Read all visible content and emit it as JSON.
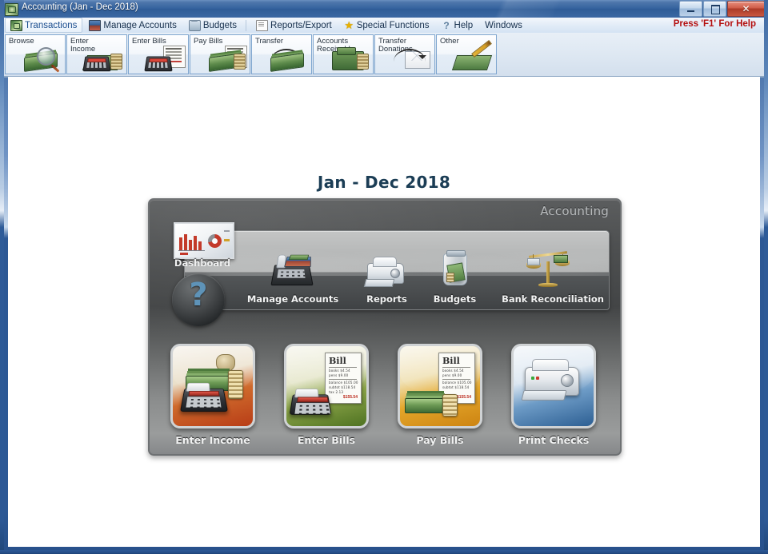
{
  "window": {
    "title": "Accounting (Jan - Dec 2018)",
    "title_icon": "money-icon",
    "controls": {
      "minimize": "minimize-button",
      "maximize": "maximize-button",
      "close_label": "✕"
    }
  },
  "menubar": {
    "items": [
      {
        "label": "Transactions",
        "icon": "money-icon",
        "active": true
      },
      {
        "label": "Manage Accounts",
        "icon": "books-icon",
        "active": false
      },
      {
        "label": "Budgets",
        "icon": "jar-icon",
        "active": false
      },
      {
        "label": "Reports/Export",
        "icon": "page-icon",
        "active": false
      },
      {
        "label": "Special Functions",
        "icon": "star-icon",
        "active": false
      },
      {
        "label": "Help",
        "icon": "help-icon",
        "active": false
      },
      {
        "label": "Windows",
        "icon": "none",
        "active": false
      }
    ],
    "help_hint": "Press 'F1' For Help"
  },
  "toolbar": {
    "buttons": [
      {
        "label": "Browse",
        "icon": "browse-magnifier-icon"
      },
      {
        "label": "Enter Income",
        "icon": "enter-income-icon"
      },
      {
        "label": "Enter Bills",
        "icon": "enter-bills-icon"
      },
      {
        "label": "Pay Bills",
        "icon": "pay-bills-icon"
      },
      {
        "label": "Transfer",
        "icon": "transfer-arrow-icon"
      },
      {
        "label": "Accounts Receivable",
        "icon": "accounts-receivable-icon"
      },
      {
        "label": "Transfer Donations",
        "icon": "transfer-donations-icon"
      },
      {
        "label": "Other",
        "icon": "other-pencil-icon"
      }
    ]
  },
  "main": {
    "period_title": "Jan - Dec 2018",
    "dashboard": {
      "header": "Accounting",
      "dashboard_button": {
        "label": "Dashboard",
        "icon": "dashboard-chart-icon"
      },
      "help_orb": {
        "label": "?",
        "icon": "question-mark-icon"
      },
      "shelf_items": [
        {
          "label": "Manage Accounts",
          "icon": "cash-register-icon"
        },
        {
          "label": "Reports",
          "icon": "printer-icon"
        },
        {
          "label": "Budgets",
          "icon": "money-jar-icon"
        },
        {
          "label": "Bank Reconciliation",
          "icon": "balance-scale-icon"
        }
      ],
      "tiles": [
        {
          "label": "Enter Income",
          "icon": "income-calculator-icon",
          "color": "#b83d17"
        },
        {
          "label": "Enter Bills",
          "icon": "bill-calculator-icon",
          "color": "#4f7322"
        },
        {
          "label": "Pay Bills",
          "icon": "pay-bills-cash-icon",
          "color": "#cd8412"
        },
        {
          "label": "Print Checks",
          "icon": "printer-icon",
          "color": "#2d5f93"
        }
      ],
      "bill_detail": {
        "title": "Bill",
        "line1": "books    $4.54",
        "line2": "pens     $9.00",
        "line3": "balance $105.00",
        "line4": "subtot  $118.54",
        "line5": "tax        2.13",
        "total": "$155.54"
      }
    }
  },
  "colors": {
    "titlebar_blue": "#35639e",
    "help_red": "#b40f0f",
    "period_title": "#1b3d55",
    "panel_gray": "#4e5051",
    "accent_blue": "#5e93b8"
  }
}
